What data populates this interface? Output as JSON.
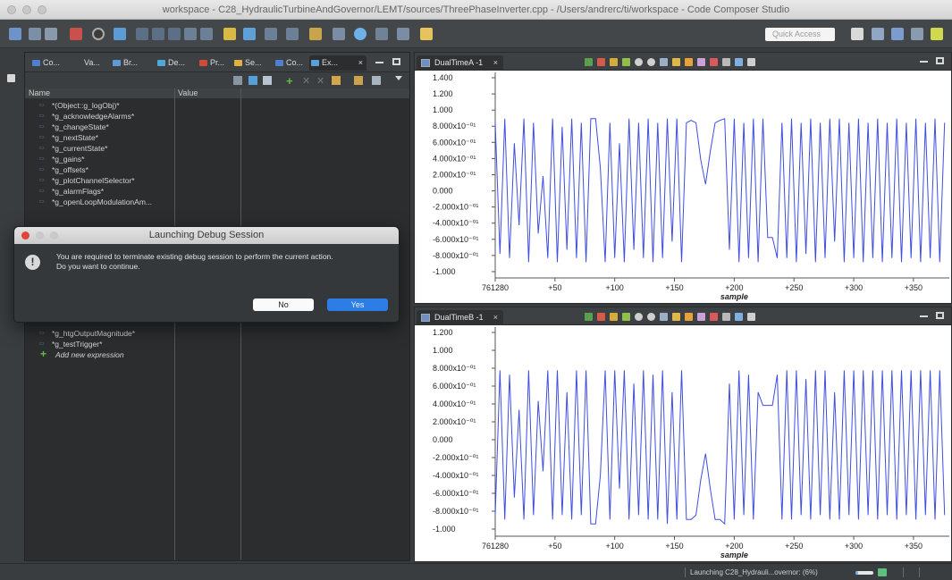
{
  "window": {
    "title": "workspace - C28_HydraulicTurbineAndGovernor/LEMT/sources/ThreePhaseInverter.cpp - /Users/andrerc/ti/workspace - Code Composer Studio"
  },
  "toolbar": {
    "quick_access": "Quick Access"
  },
  "left_panel": {
    "tabs": [
      {
        "label": "Co...",
        "icon": "console-icon",
        "color": "#4f7fd0"
      },
      {
        "label": "Va...",
        "icon": "variables-icon",
        "color": "#888888"
      },
      {
        "label": "Br...",
        "icon": "breakpoints-icon",
        "color": "#5e9bd6"
      },
      {
        "label": "De...",
        "icon": "debug-icon",
        "color": "#4fa7d8"
      },
      {
        "label": "Pr...",
        "icon": "problems-icon",
        "color": "#d04c3a"
      },
      {
        "label": "Se...",
        "icon": "search-icon",
        "color": "#e0b040"
      },
      {
        "label": "Co...",
        "icon": "console-icon",
        "color": "#4f7fd0"
      },
      {
        "label": "Ex...",
        "icon": "expressions-icon",
        "color": "#5aa0d8"
      }
    ],
    "columns": {
      "name": "Name",
      "value": "Value"
    },
    "expressions": [
      "*(Object::g_logObj)*",
      "*g_acknowledgeAlarms*",
      "*g_changeState*",
      "*g_nextState*",
      "*g_currentState*",
      "*g_gains*",
      "*g_offsets*",
      "*g_plotChannelSelector*",
      "*g_alarmFlags*",
      "*g_openLoopModulationAm..."
    ],
    "expressions_below": [
      "*g_htgOutputMagnitude*",
      "*g_testTrigger*"
    ],
    "add_expression": "Add new expression"
  },
  "dialog": {
    "title": "Launching Debug Session",
    "message_line1": "You are required to terminate existing debug session to perform the current action.",
    "message_line2": "Do you want to continue.",
    "no_label": "No",
    "yes_label": "Yes"
  },
  "graphs": [
    {
      "tab_label": "DualTimeA -1",
      "close_label": "×",
      "y_ticks": [
        "1.400",
        "1.200",
        "1.000",
        "8.000x10⁻⁰¹",
        "6.000x10⁻⁰¹",
        "4.000x10⁻⁰¹",
        "2.000x10⁻⁰¹",
        "0.000",
        "-2.000x10⁻⁰¹",
        "-4.000x10⁻⁰¹",
        "-6.000x10⁻⁰¹",
        "-8.000x10⁻⁰¹",
        "-1.000"
      ],
      "x_ticks": [
        "761280",
        "+50",
        "+100",
        "+150",
        "+200",
        "+250",
        "+300",
        "+350"
      ],
      "x_label": "sample"
    },
    {
      "tab_label": "DualTimeB -1",
      "close_label": "×",
      "y_ticks": [
        "1.200",
        "1.000",
        "8.000x10⁻⁰¹",
        "6.000x10⁻⁰¹",
        "4.000x10⁻⁰¹",
        "2.000x10⁻⁰¹",
        "0.000",
        "-2.000x10⁻⁰¹",
        "-4.000x10⁻⁰¹",
        "-6.000x10⁻⁰¹",
        "-8.000x10⁻⁰¹",
        "-1.000"
      ],
      "x_ticks": [
        "761280",
        "+50",
        "+100",
        "+150",
        "+200",
        "+250",
        "+300",
        "+350"
      ],
      "x_label": "sample"
    }
  ],
  "chart_data": [
    {
      "type": "line",
      "x_start": 761280,
      "ylim": [
        -1.0,
        1.4
      ],
      "xlim": [
        0,
        380
      ],
      "line_color": "#3f4de0",
      "x": [
        0,
        4,
        8,
        12,
        16,
        20,
        24,
        28,
        32,
        36,
        40,
        44,
        48,
        52,
        56,
        60,
        64,
        68,
        72,
        76,
        80,
        84,
        88,
        92,
        96,
        100,
        104,
        108,
        112,
        116,
        120,
        124,
        128,
        132,
        136,
        140,
        144,
        148,
        152,
        156,
        160,
        164,
        168,
        172,
        176,
        180,
        184,
        188,
        192,
        196,
        200,
        204,
        208,
        212,
        216,
        220,
        224,
        228,
        232,
        236,
        240,
        244,
        248,
        252,
        256,
        260,
        264,
        268,
        272,
        276,
        280,
        284,
        288,
        292,
        296,
        300,
        304,
        308,
        312,
        316,
        320,
        324,
        328,
        332,
        336,
        340,
        344,
        348,
        352,
        356,
        360,
        364,
        368,
        372,
        376
      ],
      "y": [
        0.85,
        -0.75,
        0.9,
        -0.8,
        0.6,
        -0.4,
        0.9,
        -0.85,
        0.85,
        -0.5,
        0.2,
        -0.8,
        0.9,
        -0.85,
        0.8,
        -0.7,
        0.9,
        -0.8,
        0.85,
        -0.85,
        0.9,
        0.9,
        0.3,
        -0.85,
        0.85,
        -0.8,
        0.6,
        -0.85,
        0.9,
        -0.7,
        0.85,
        -0.8,
        0.9,
        -0.85,
        0.85,
        -0.8,
        0.9,
        -0.6,
        0.9,
        -0.85,
        0.85,
        0.88,
        0.85,
        0.4,
        0.1,
        0.5,
        0.85,
        0.88,
        0.9,
        -0.7,
        0.9,
        -0.85,
        0.85,
        -0.8,
        0.9,
        -0.85,
        0.9,
        -0.55,
        -0.55,
        -0.8,
        0.85,
        -0.8,
        0.9,
        -0.85,
        0.85,
        -0.75,
        0.9,
        -0.85,
        0.85,
        -0.8,
        0.9,
        -0.6,
        0.9,
        -0.85,
        0.85,
        -0.8,
        0.9,
        -0.85,
        0.85,
        -0.8,
        0.9,
        -0.85,
        0.85,
        -0.8,
        0.9,
        -0.85,
        0.85,
        -0.8,
        0.9,
        -0.85,
        0.85,
        -0.8,
        0.9,
        -0.85,
        0.85
      ]
    },
    {
      "type": "line",
      "x_start": 761280,
      "ylim": [
        -1.0,
        1.2
      ],
      "xlim": [
        0,
        380
      ],
      "line_color": "#3f4de0",
      "x": [
        0,
        4,
        8,
        12,
        16,
        20,
        24,
        28,
        32,
        36,
        40,
        44,
        48,
        52,
        56,
        60,
        64,
        68,
        72,
        76,
        80,
        84,
        88,
        92,
        96,
        100,
        104,
        108,
        112,
        116,
        120,
        124,
        128,
        132,
        136,
        140,
        144,
        148,
        152,
        156,
        160,
        164,
        168,
        172,
        176,
        180,
        184,
        188,
        192,
        196,
        200,
        204,
        208,
        212,
        216,
        220,
        224,
        228,
        232,
        236,
        240,
        244,
        248,
        252,
        256,
        260,
        264,
        268,
        272,
        276,
        280,
        284,
        288,
        292,
        296,
        300,
        304,
        308,
        312,
        316,
        320,
        324,
        328,
        332,
        336,
        340,
        344,
        348,
        352,
        356,
        360,
        364,
        368,
        372,
        376
      ],
      "y": [
        -0.8,
        0.85,
        -0.85,
        0.8,
        -0.6,
        0.4,
        -0.85,
        0.85,
        -0.8,
        0.5,
        -0.3,
        0.85,
        -0.85,
        0.85,
        -0.8,
        0.6,
        -0.85,
        0.85,
        -0.8,
        0.85,
        -0.9,
        -0.9,
        -0.35,
        0.85,
        -0.85,
        0.85,
        -0.5,
        0.85,
        -0.85,
        0.7,
        -0.8,
        0.85,
        -0.85,
        0.8,
        -0.85,
        0.85,
        -0.9,
        0.6,
        -0.85,
        0.85,
        -0.85,
        -0.85,
        -0.8,
        -0.4,
        -0.1,
        -0.5,
        -0.85,
        -0.85,
        -0.9,
        0.7,
        -0.85,
        0.85,
        -0.8,
        0.8,
        -0.85,
        0.6,
        0.45,
        0.45,
        0.45,
        0.8,
        -0.85,
        0.85,
        -0.85,
        0.85,
        -0.8,
        0.75,
        -0.85,
        0.85,
        -0.8,
        0.85,
        -0.85,
        0.6,
        -0.85,
        0.85,
        -0.8,
        0.85,
        -0.85,
        0.85,
        -0.8,
        0.85,
        -0.85,
        0.85,
        -0.8,
        0.85,
        -0.85,
        0.85,
        -0.8,
        0.85,
        -0.85,
        0.85,
        -0.8,
        0.85,
        -0.85,
        0.85,
        -0.8
      ]
    }
  ],
  "status": {
    "text": "Launching C28_Hydrauli...overnor: (6%)",
    "progress": 0.06
  }
}
